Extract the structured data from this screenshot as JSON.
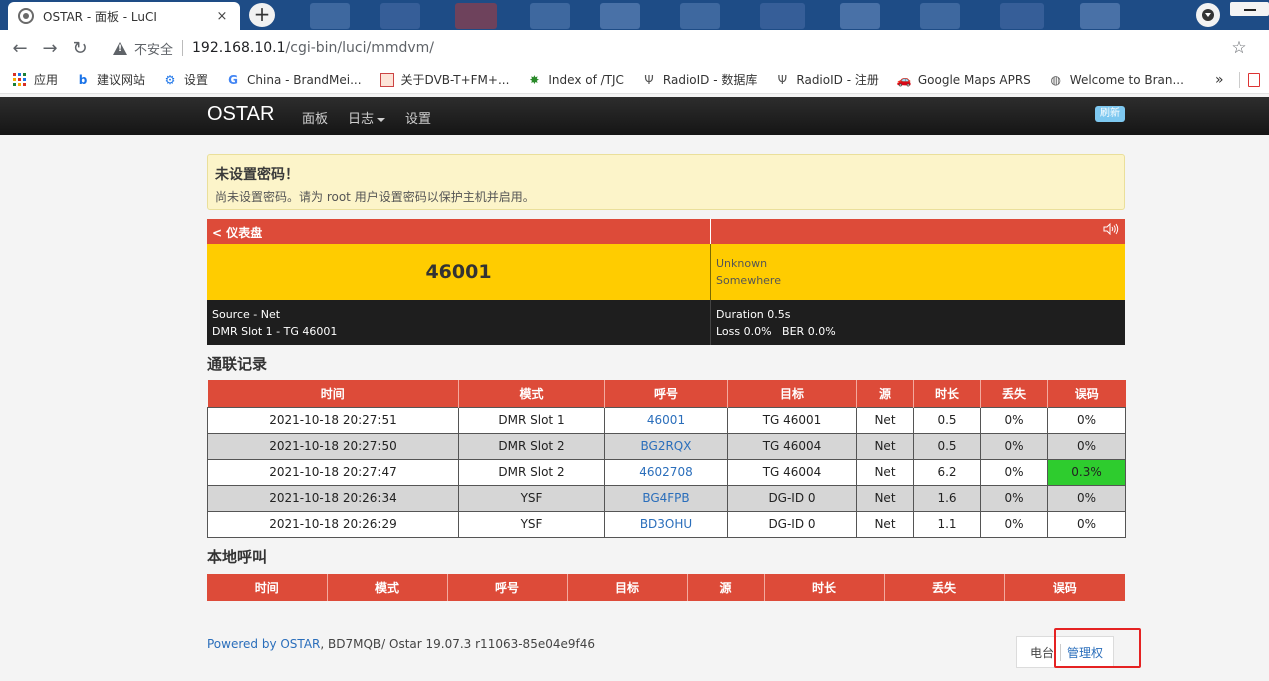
{
  "browser": {
    "tab_title": "OSTAR - 面板 - LuCI",
    "tab_close": "×",
    "new_tab": "+",
    "back": "←",
    "forward": "→",
    "reload": "↻",
    "insecure_label": "不安全",
    "url_host": "192.168.10.1",
    "url_path": "/cgi-bin/luci/mmdvm/",
    "star": "☆",
    "bookmarks": [
      {
        "label": "应用",
        "icon": "apps-icon"
      },
      {
        "label": "建议网站",
        "icon": "bing-icon"
      },
      {
        "label": "设置",
        "icon": "gear-icon"
      },
      {
        "label": "China - BrandMei...",
        "icon": "google-icon"
      },
      {
        "label": "关于DVB-T+FM+...",
        "icon": "image-icon"
      },
      {
        "label": "Index of /TJC",
        "icon": "pinwheel-icon"
      },
      {
        "label": "RadioID - 数据库",
        "icon": "antenna-icon"
      },
      {
        "label": "RadioID - 注册",
        "icon": "antenna-icon"
      },
      {
        "label": "Google Maps APRS",
        "icon": "car-icon"
      },
      {
        "label": "Welcome to Bran...",
        "icon": "globe-icon"
      }
    ],
    "bookmarks_more": "»"
  },
  "header": {
    "brand": "OSTAR",
    "menu": [
      {
        "label": "面板"
      },
      {
        "label": "日志",
        "dropdown": true
      },
      {
        "label": "设置"
      }
    ],
    "refresh_label": "刷新"
  },
  "alert": {
    "title": "未设置密码！",
    "text": "尚未设置密码。请为 root 用户设置密码以保护主机并启用。"
  },
  "dashboard": {
    "title": "< 仪表盘",
    "audio_icon": "🔊",
    "talkgroup": "46001",
    "name": "Unknown",
    "location": "Somewhere",
    "source": "Source - Net",
    "slot_info": "DMR Slot 1 - TG 46001",
    "duration": "Duration 0.5s",
    "loss_ber": "Loss 0.0%   BER 0.0%"
  },
  "call_log": {
    "title": "通联记录",
    "headers": [
      "时间",
      "模式",
      "呼号",
      "目标",
      "源",
      "时长",
      "丢失",
      "误码"
    ],
    "rows": [
      [
        "2021-10-18 20:27:51",
        "DMR Slot 1",
        "46001",
        "TG 46001",
        "Net",
        "0.5",
        "0%",
        "0%"
      ],
      [
        "2021-10-18 20:27:50",
        "DMR Slot 2",
        "BG2RQX",
        "TG 46004",
        "Net",
        "0.5",
        "0%",
        "0%"
      ],
      [
        "2021-10-18 20:27:47",
        "DMR Slot 2",
        "4602708",
        "TG 46004",
        "Net",
        "6.2",
        "0%",
        "0.3%"
      ],
      [
        "2021-10-18 20:26:34",
        "YSF",
        "BG4FPB",
        "DG-ID 0",
        "Net",
        "1.6",
        "0%",
        "0%"
      ],
      [
        "2021-10-18 20:26:29",
        "YSF",
        "BD3OHU",
        "DG-ID 0",
        "Net",
        "1.1",
        "0%",
        "0%"
      ]
    ],
    "colors": {
      "header": "#dd4b39",
      "ber_high": "#2ecc2e"
    }
  },
  "local_calls": {
    "title": "本地呼叫",
    "headers": [
      "时间",
      "模式",
      "呼号",
      "目标",
      "源",
      "时长",
      "丢失",
      "误码"
    ]
  },
  "footer": {
    "powered_link": "Powered by OSTAR",
    "version": ", BD7MQB/ Ostar 19.07.3 r11063-85e04e9f46",
    "tab_station": "电台",
    "tab_admin": "管理权"
  }
}
